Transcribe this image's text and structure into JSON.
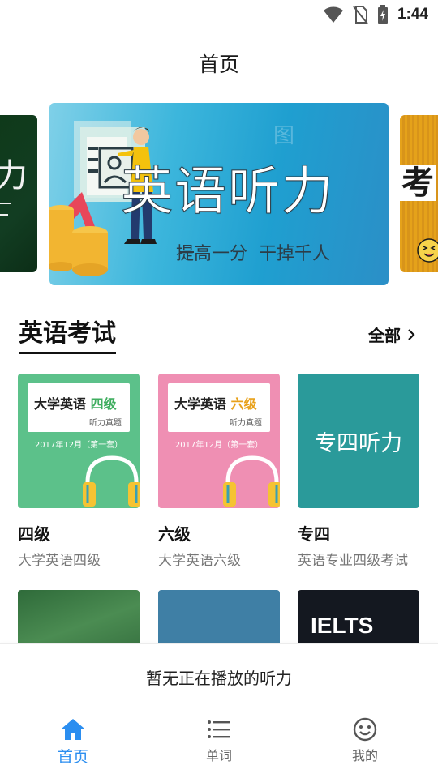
{
  "status_bar": {
    "time": "1:44"
  },
  "header": {
    "title": "首页"
  },
  "banner": {
    "main_title": "英语听力",
    "main_slogan": "提高一分  干掉千人",
    "left_peek_text": "力",
    "right_peek_text": "考",
    "watermark": "图"
  },
  "section": {
    "title": "英语考试",
    "see_all_label": "全部"
  },
  "cards": [
    {
      "title": "四级",
      "subtitle": "大学英语四级",
      "cover_title_a": "大学英语",
      "cover_title_b": "四级",
      "cover_box_sub": "听力真题",
      "cover_date": "2017年12月（第一套）",
      "accent": "#5cc18a",
      "label_color": "#3fae5f"
    },
    {
      "title": "六级",
      "subtitle": "大学英语六级",
      "cover_title_a": "大学英语",
      "cover_title_b": "六级",
      "cover_box_sub": "听力真题",
      "cover_date": "2017年12月（第一套）",
      "accent": "#ef8fb3",
      "label_color": "#e8a11a"
    },
    {
      "title": "专四",
      "subtitle": "英语专业四级考试",
      "cover_text": "专四听力",
      "accent": "#2a9a9a"
    }
  ],
  "row2": {
    "ielts_text": "IELTS"
  },
  "mini_player": {
    "text": "暂无正在播放的听力"
  },
  "bottom_nav": [
    {
      "label": "首页",
      "icon": "home-icon",
      "active": true
    },
    {
      "label": "单词",
      "icon": "list-icon",
      "active": false
    },
    {
      "label": "我的",
      "icon": "smiley-icon",
      "active": false
    }
  ],
  "colors": {
    "accent_blue": "#2b8ef0"
  }
}
